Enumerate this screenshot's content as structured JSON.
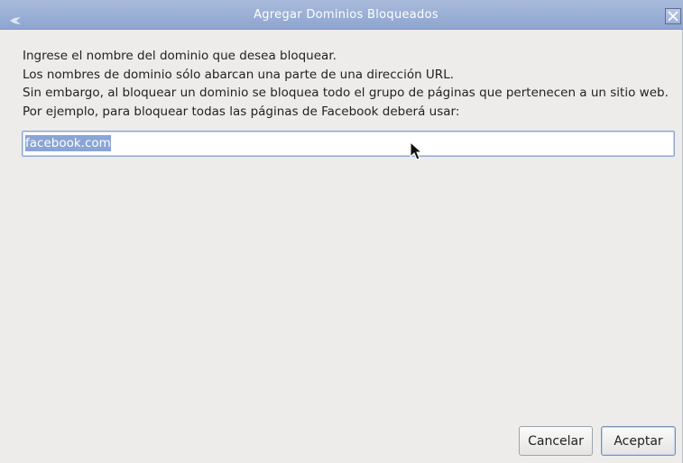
{
  "window": {
    "title": "Agregar Dominios Bloqueados"
  },
  "instructions": {
    "lines": [
      "Ingrese el nombre del dominio que desea bloquear.",
      "Los nombres de dominio sólo abarcan una parte de una dirección URL.",
      "Sin embargo, al bloquear un dominio se bloquea todo el grupo de páginas que pertenecen a un sitio web.",
      "Por ejemplo, para bloquear todas las páginas de Facebook deberá usar:"
    ]
  },
  "domain_input": {
    "value": "facebook.com",
    "selected": true
  },
  "buttons": {
    "cancel_label": "Cancelar",
    "ok_label": "Aceptar"
  },
  "icons": {
    "app": "app-icon",
    "close": "close-icon",
    "cursor": "mouse-pointer-icon"
  },
  "colors": {
    "titlebar": "#8ea5cf",
    "window_bg": "#edeceb",
    "selection": "#8aa4d6"
  }
}
